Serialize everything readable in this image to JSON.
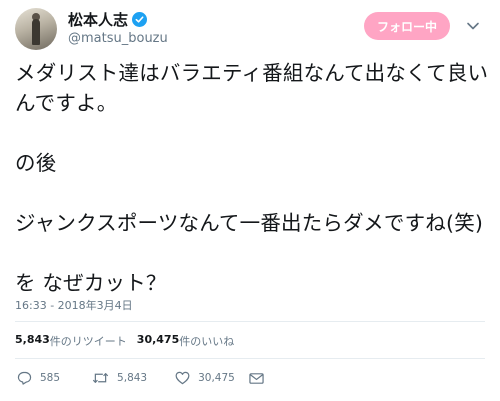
{
  "user": {
    "display_name": "松本人志",
    "handle": "@matsu_bouzu",
    "verified_icon": "verified-badge-icon"
  },
  "follow_button": {
    "label": "フォロー中"
  },
  "tweet": {
    "text": "メダリスト達はバラエティ番組なんて出なくて良いんですよ。\n\nの後\n\nジャンクスポーツなんて一番出たらダメですね(笑)\n\nを なぜカット？",
    "timestamp": "16:33 - 2018年3月4日"
  },
  "stats": {
    "retweets_count": "5,843",
    "retweets_label": "件のリツイート",
    "likes_count": "30,475",
    "likes_label": "件のいいね"
  },
  "actions": {
    "reply_count": "585",
    "retweet_count": "5,843",
    "like_count": "30,475"
  },
  "colors": {
    "follow_button_bg": "#ffa5c4",
    "verified": "#1da1f2",
    "secondary_text": "#657786"
  }
}
